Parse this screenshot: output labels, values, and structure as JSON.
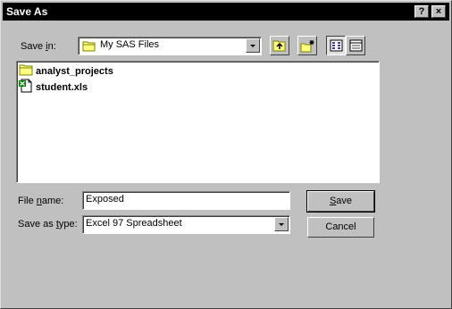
{
  "window": {
    "title": "Save As",
    "help_button": "?",
    "close_button": "×"
  },
  "save_in": {
    "label_pre": "Save ",
    "label_key": "i",
    "label_post": "n:",
    "value": "My SAS Files"
  },
  "files": [
    {
      "name": "analyst_projects",
      "icon": "folder-icon"
    },
    {
      "name": "student.xls",
      "icon": "excel-file-icon"
    }
  ],
  "file_name": {
    "label_pre": "File ",
    "label_key": "n",
    "label_post": "ame:",
    "value": "Exposed"
  },
  "save_as_type": {
    "label_pre": "Save as ",
    "label_key": "t",
    "label_post": "ype:",
    "value": "Excel 97 Spreadsheet"
  },
  "buttons": {
    "save_key": "S",
    "save_rest": "ave",
    "cancel": "Cancel"
  }
}
